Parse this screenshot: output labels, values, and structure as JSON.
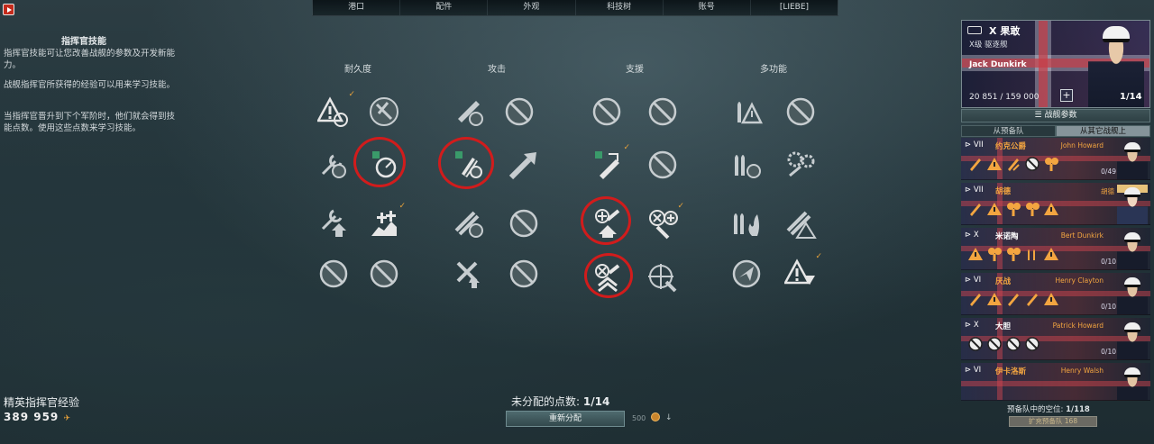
{
  "nav": {
    "tabs": [
      "港口",
      "配件",
      "外观",
      "科技树",
      "账号",
      "[LIEBE]"
    ]
  },
  "info": {
    "title": "指挥官技能",
    "p1": "指挥官技能可让您改善战舰的参数及开发新能力。",
    "p2": "战舰指挥官所获得的经验可以用来学习技能。",
    "p3": "当指挥官晋升到下个军阶时，他们就会得到技能点数。使用这些点数来学习技能。"
  },
  "elite": {
    "label": "精英指挥官经验",
    "value": "389 959"
  },
  "categories": [
    "耐久度",
    "攻击",
    "支援",
    "多功能"
  ],
  "unassigned": {
    "label": "未分配的点数:",
    "value": "1/14"
  },
  "reset": {
    "label": "重新分配",
    "cost": "500"
  },
  "commander": {
    "tier": "X",
    "ship": "果敢",
    "class": "X级  驱逐舰",
    "name": "Jack  Dunkirk",
    "xp": "20  851 / 159  000",
    "points": "1/14",
    "params_button": "战舰参数",
    "subtabs": [
      "从预备队",
      "从其它战舰上"
    ]
  },
  "commanders": [
    {
      "tier": "VII",
      "ship": "约克公爵",
      "name": "John  Howard",
      "points": "0/49"
    },
    {
      "tier": "VII",
      "ship": "胡德",
      "name": "胡德",
      "points": ""
    },
    {
      "tier": "X",
      "ship": "米诺陶",
      "name": "Bert  Dunkirk",
      "points": "0/10"
    },
    {
      "tier": "VI",
      "ship": "厌战",
      "name": "Henry  Clayton",
      "points": "0/10"
    },
    {
      "tier": "X",
      "ship": "大胆",
      "name": "Patrick  Howard",
      "points": "0/10"
    },
    {
      "tier": "VI",
      "ship": "伊卡洛斯",
      "name": "Henry  Walsh",
      "points": ""
    }
  ],
  "reserve": {
    "label": "预备队中的空位:",
    "value": "1/118",
    "button": "扩充预备队",
    "cost": "168"
  },
  "colors": {
    "accent": "#f3a540",
    "highlight": "#d11c1c",
    "check": "#e8a23a"
  }
}
